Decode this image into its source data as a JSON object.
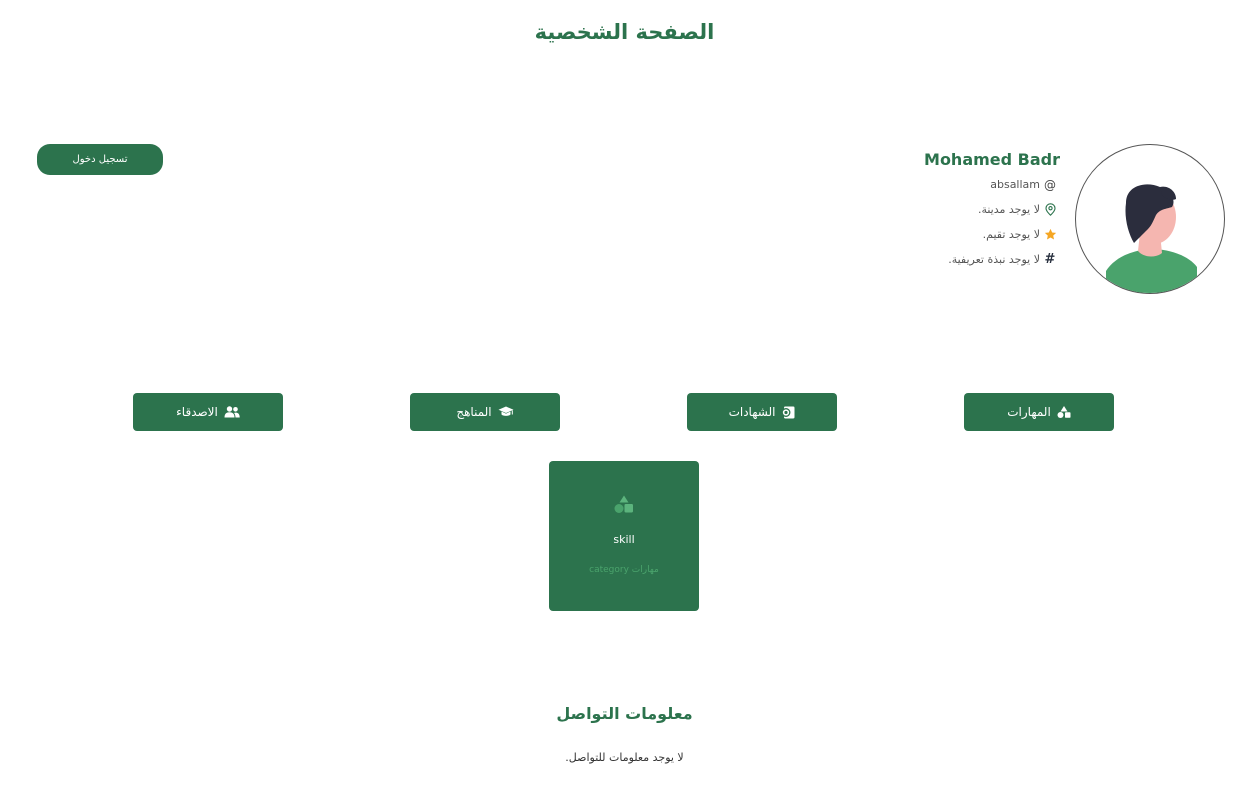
{
  "page": {
    "title": "الصفحة الشخصية"
  },
  "header": {
    "login_label": "تسجيل دخول"
  },
  "profile": {
    "name": "Mohamed Badr",
    "username": "absallam",
    "city": "لا يوجد مدينة.",
    "rating": "لا يوجد تقيم.",
    "bio": "لا يوجد نبذة تعريفية.",
    "avatar_icon": "user-avatar-icon"
  },
  "tabs": [
    {
      "label": "المهارات",
      "icon": "shapes-icon"
    },
    {
      "label": "الشهادات",
      "icon": "certificate-icon"
    },
    {
      "label": "المناهج",
      "icon": "graduation-cap-icon"
    },
    {
      "label": "الاصدقاء",
      "icon": "users-icon"
    }
  ],
  "skills": [
    {
      "name": "skill",
      "category": "مهارات category",
      "icon": "shapes-icon"
    }
  ],
  "contact": {
    "title": "معلومات التواصل",
    "empty_message": "لا يوجد معلومات للتواصل."
  },
  "colors": {
    "primary": "#2c734d",
    "accent_light": "#4aa36c",
    "star": "#f5a623"
  }
}
